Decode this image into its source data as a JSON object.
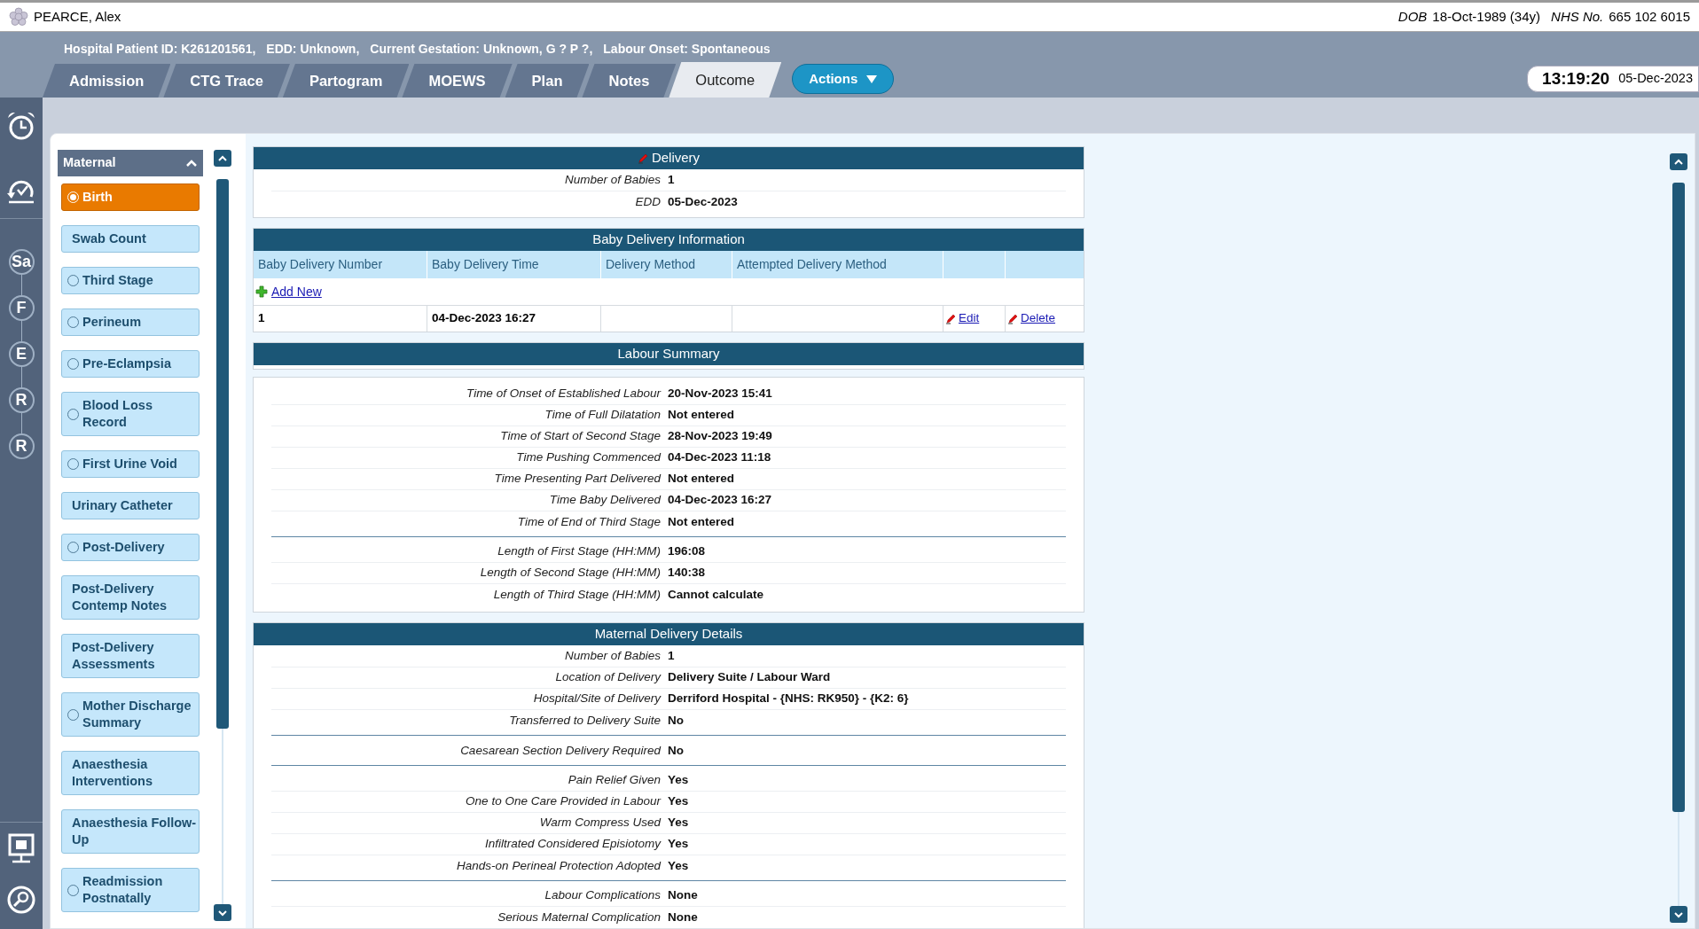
{
  "patient": {
    "name": "PEARCE, Alex",
    "dob_label": "DOB",
    "dob": "18-Oct-1989 (34y)",
    "nhs_label": "NHS No.",
    "nhs": "665 102 6015"
  },
  "banner": [
    "Hospital Patient ID: K261201561,",
    "EDD: Unknown,",
    "Current Gestation: Unknown, G ? P ?,",
    "Labour Onset: Spontaneous"
  ],
  "tabs": [
    {
      "label": "Admission",
      "selected": false
    },
    {
      "label": "CTG Trace",
      "selected": false
    },
    {
      "label": "Partogram",
      "selected": false
    },
    {
      "label": "MOEWS",
      "selected": false
    },
    {
      "label": "Plan",
      "selected": false
    },
    {
      "label": "Notes",
      "selected": false
    },
    {
      "label": "Outcome",
      "selected": true
    }
  ],
  "actions_button": "Actions",
  "clock": {
    "time": "13:19:20",
    "date": "05-Dec-2023"
  },
  "rail_letters": [
    "Sa",
    "F",
    "E",
    "R",
    "R"
  ],
  "menu": {
    "title": "Maternal",
    "expanded": true,
    "items": [
      {
        "label": "Birth",
        "kind": "radio",
        "selected": true
      },
      {
        "label": "Swab Count",
        "kind": "plain",
        "selected": false
      },
      {
        "label": "Third Stage",
        "kind": "radio",
        "selected": false
      },
      {
        "label": "Perineum",
        "kind": "radio",
        "selected": false
      },
      {
        "label": "Pre-Eclampsia",
        "kind": "radio",
        "selected": false
      },
      {
        "label": "Blood Loss Record",
        "kind": "radio",
        "selected": false
      },
      {
        "label": "First Urine Void",
        "kind": "radio",
        "selected": false
      },
      {
        "label": "Urinary Catheter",
        "kind": "plain",
        "selected": false
      },
      {
        "label": "Post-Delivery",
        "kind": "radio",
        "selected": false
      },
      {
        "label": "Post-Delivery Contemp Notes",
        "kind": "plain",
        "selected": false
      },
      {
        "label": "Post-Delivery Assessments",
        "kind": "plain",
        "selected": false
      },
      {
        "label": "Mother Discharge Summary",
        "kind": "radio",
        "selected": false
      },
      {
        "label": "Anaesthesia Interventions",
        "kind": "plain",
        "selected": false
      },
      {
        "label": "Anaesthesia Follow-Up",
        "kind": "plain",
        "selected": false
      },
      {
        "label": "Readmission Postnatally",
        "kind": "radio",
        "selected": false
      }
    ]
  },
  "sections": [
    {
      "kind": "editable_fields",
      "title": "Delivery",
      "groups": [
        [
          {
            "label": "Number of Babies",
            "value": "1"
          },
          {
            "label": "EDD",
            "value": "05-Dec-2023"
          }
        ]
      ]
    },
    {
      "kind": "table",
      "title": "Baby Delivery Information",
      "columns": [
        "Baby Delivery Number",
        "Baby Delivery Time",
        "Delivery Method",
        "Attempted Delivery Method"
      ],
      "add_new": "Add New",
      "rows": [
        {
          "cells": [
            "1",
            "04-Dec-2023 16:27"
          ],
          "actions": [
            "Edit",
            "Delete"
          ]
        }
      ]
    },
    {
      "kind": "split_fields",
      "title": "Labour Summary",
      "groups": [
        [
          {
            "label": "Time of Onset of Established Labour",
            "value": "20-Nov-2023 15:41"
          },
          {
            "label": "Time of Full Dilatation",
            "value": "Not entered"
          },
          {
            "label": "Time of Start of Second Stage",
            "value": "28-Nov-2023 19:49"
          },
          {
            "label": "Time Pushing Commenced",
            "value": "04-Dec-2023 11:18"
          },
          {
            "label": "Time Presenting Part Delivered",
            "value": "Not entered"
          },
          {
            "label": "Time Baby Delivered",
            "value": "04-Dec-2023 16:27"
          },
          {
            "label": "Time of End of Third Stage",
            "value": "Not entered"
          }
        ],
        [
          {
            "label": "Length of First Stage (HH:MM)",
            "value": "196:08"
          },
          {
            "label": "Length of Second Stage (HH:MM)",
            "value": "140:38"
          },
          {
            "label": "Length of Third Stage (HH:MM)",
            "value": "Cannot calculate"
          }
        ]
      ]
    },
    {
      "kind": "fields",
      "title": "Maternal Delivery Details",
      "groups": [
        [
          {
            "label": "Number of Babies",
            "value": "1"
          },
          {
            "label": "Location of Delivery",
            "value": "Delivery Suite / Labour Ward"
          },
          {
            "label": "Hospital/Site of Delivery",
            "value": "Derriford Hospital - {NHS: RK950} - {K2: 6}"
          },
          {
            "label": "Transferred to Delivery Suite",
            "value": "No"
          }
        ],
        [
          {
            "label": "Caesarean Section Delivery Required",
            "value": "No"
          }
        ],
        [
          {
            "label": "Pain Relief Given",
            "value": "Yes"
          },
          {
            "label": "One to One Care Provided in Labour",
            "value": "Yes"
          },
          {
            "label": "Warm Compress Used",
            "value": "Yes"
          },
          {
            "label": "Infiltrated Considered Episiotomy",
            "value": "Yes"
          },
          {
            "label": "Hands-on Perineal Protection Adopted",
            "value": "Yes"
          }
        ],
        [
          {
            "label": "Labour Complications",
            "value": "None"
          },
          {
            "label": "Serious Maternal Complication",
            "value": "None"
          }
        ]
      ]
    }
  ]
}
